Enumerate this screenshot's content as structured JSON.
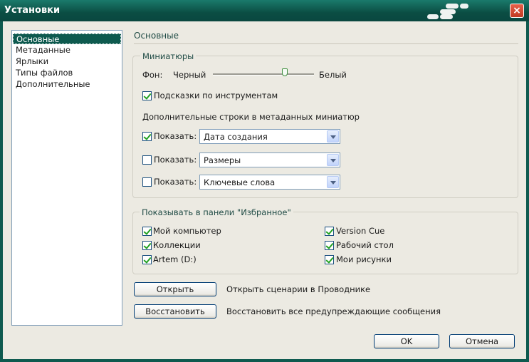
{
  "window": {
    "title": "Установки"
  },
  "sidebar": {
    "items": [
      {
        "label": "Основные",
        "selected": true
      },
      {
        "label": "Метаданные",
        "selected": false
      },
      {
        "label": "Ярлыки",
        "selected": false
      },
      {
        "label": "Типы файлов",
        "selected": false
      },
      {
        "label": "Дополнительные",
        "selected": false
      }
    ]
  },
  "main": {
    "title": "Основные",
    "thumbnails": {
      "label": "Миниатюры",
      "background_label": "Фон:",
      "slider_min_label": "Черный",
      "slider_max_label": "Белый",
      "slider_value": 0.72,
      "tooltips": {
        "label": "Подсказки по инструментам",
        "checked": true
      },
      "extra_lines_label": "Дополнительные строки в метаданных миниатюр",
      "rows": [
        {
          "show_label": "Показать:",
          "checked": true,
          "value": "Дата создания"
        },
        {
          "show_label": "Показать:",
          "checked": false,
          "value": "Размеры"
        },
        {
          "show_label": "Показать:",
          "checked": false,
          "value": "Ключевые слова"
        }
      ]
    },
    "favorites": {
      "label": "Показывать в панели \"Избранное\"",
      "left": [
        {
          "label": "Мой компьютер",
          "checked": true
        },
        {
          "label": "Коллекции",
          "checked": true
        },
        {
          "label": "Artem (D:)",
          "checked": true
        }
      ],
      "right": [
        {
          "label": "Version Cue",
          "checked": true
        },
        {
          "label": "Рабочий стол",
          "checked": true
        },
        {
          "label": "Мои рисунки",
          "checked": true
        }
      ]
    },
    "actions": {
      "open_button": "Открыть",
      "open_desc": "Открыть сценарии в Проводнике",
      "restore_button": "Восстановить",
      "restore_desc": "Восстановить все предупреждающие сообщения"
    }
  },
  "footer": {
    "ok": "OK",
    "cancel": "Отмена"
  }
}
